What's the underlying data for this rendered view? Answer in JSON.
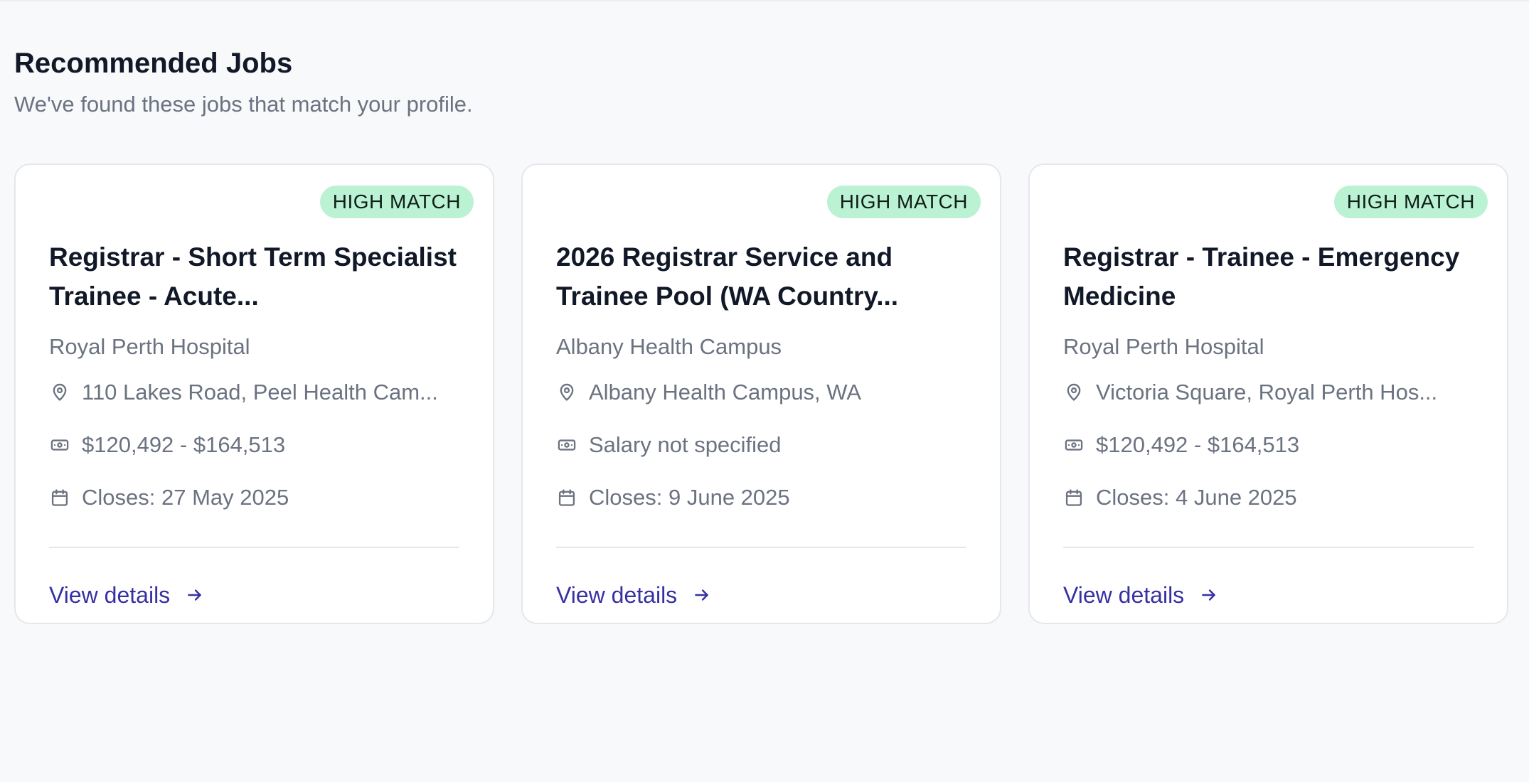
{
  "section": {
    "title": "Recommended Jobs",
    "subtitle": "We've found these jobs that match your profile."
  },
  "jobs": [
    {
      "badge": "HIGH MATCH",
      "title": "Registrar - Short Term Specialist Trainee - Acute...",
      "employer": "Royal Perth Hospital",
      "location": "110 Lakes Road, Peel Health Cam...",
      "salary": "$120,492 - $164,513",
      "closes": "Closes: 27 May 2025",
      "link": "View details"
    },
    {
      "badge": "HIGH MATCH",
      "title": "2026 Registrar Service and Trainee Pool (WA Country...",
      "employer": "Albany Health Campus",
      "location": "Albany Health Campus, WA",
      "salary": "Salary not specified",
      "closes": "Closes: 9 June 2025",
      "link": "View details"
    },
    {
      "badge": "HIGH MATCH",
      "title": "Registrar - Trainee - Emergency Medicine",
      "employer": "Royal Perth Hospital",
      "location": "Victoria Square, Royal Perth Hos...",
      "salary": "$120,492 - $164,513",
      "closes": "Closes: 4 June 2025",
      "link": "View details"
    }
  ],
  "icons": {
    "location": "map-pin-icon",
    "salary": "banknote-icon",
    "closes": "calendar-icon",
    "link": "arrow-right-icon"
  },
  "colors": {
    "badge_bg": "#bbf2d4",
    "link": "#3730a3",
    "muted_text": "#6b7280",
    "card_border": "#e5e7eb",
    "page_bg": "#f8f9fb"
  }
}
